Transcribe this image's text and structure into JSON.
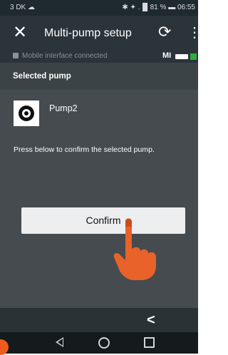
{
  "status_bar": {
    "left": "3 DK ☁",
    "right": "✱ ✦ .▐▌81 % ▬ 06:55"
  },
  "app_bar": {
    "close_icon": "✕",
    "title": "Multi-pump setup",
    "refresh_icon": "⟳",
    "menu_icon": "⋮"
  },
  "connection": {
    "text": "Mobile interface connected",
    "badge": "MI"
  },
  "section_header": "Selected pump",
  "pump": {
    "name": "Pump2"
  },
  "instruction": "Press below to confirm the selected pump.",
  "confirm_label": "Confirm",
  "soft_back": "<",
  "colors": {
    "app_bar": "#2a3439",
    "background": "#454b4f",
    "connected_indicator": "#2fae3e",
    "hand": "#e8622a"
  }
}
